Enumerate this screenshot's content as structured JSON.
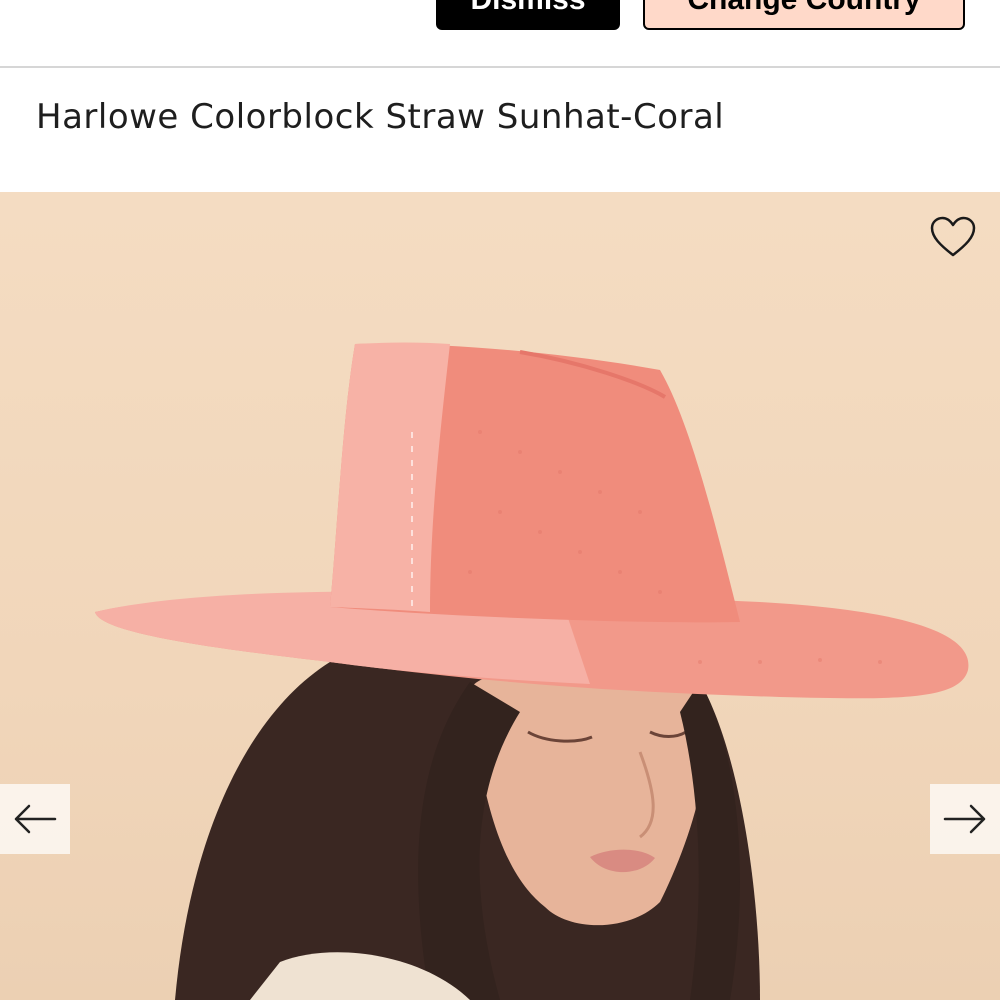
{
  "banner": {
    "dismiss_label": "Dismiss",
    "change_country_label": "Change Country"
  },
  "product": {
    "title": "Harlowe Colorblock Straw Sunhat-Coral",
    "image_alt": "Model wearing coral colorblock straw sunhat"
  },
  "gallery": {
    "prev_icon": "arrow-left-icon",
    "next_icon": "arrow-right-icon",
    "wishlist_icon": "heart-outline-icon"
  },
  "colors": {
    "background_image": "#f1d6ba",
    "hat_light": "#f7a89c",
    "hat_dark": "#ef8a78",
    "hair": "#3a2722",
    "skin": "#e7b49a"
  }
}
